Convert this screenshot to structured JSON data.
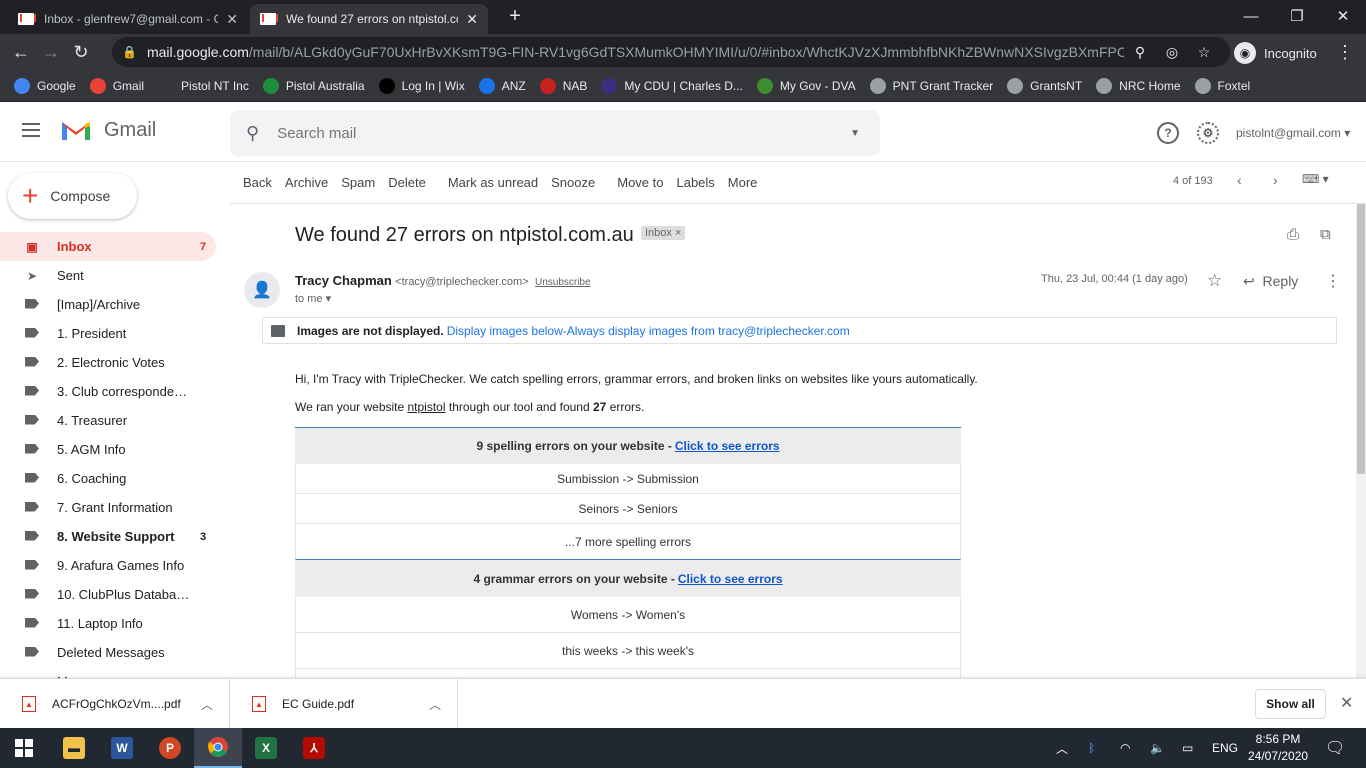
{
  "browser": {
    "tabs": [
      {
        "title": "Inbox - glenfrew7@gmail.com - G"
      },
      {
        "title": "We found 27 errors on ntpistol.co"
      }
    ],
    "url_main": "mail.google.com",
    "url_rest": "/mail/b/ALGkd0yGuF70UxHrBvXKsmT9G-FIN-RV1vg6GdTSXMumkOHMYIMI/u/0/#inbox/WhctKJVzXJmmbhfbNKhZBWnwNXSIvgzBXmFPCR...",
    "incognito_label": "Incognito",
    "bookmarks": [
      {
        "label": "Google",
        "color": "#4285f4"
      },
      {
        "label": "Gmail",
        "color": "#ea4335"
      },
      {
        "label": "Pistol NT Inc",
        "color": "#35363a"
      },
      {
        "label": "Pistol Australia",
        "color": "#1e8e3e"
      },
      {
        "label": "Log In | Wix",
        "color": "#000000"
      },
      {
        "label": "ANZ",
        "color": "#1a73e8"
      },
      {
        "label": "NAB",
        "color": "#c5221f"
      },
      {
        "label": "My CDU | Charles D...",
        "color": "#3c2f80"
      },
      {
        "label": "My Gov - DVA",
        "color": "#3c8d2f"
      },
      {
        "label": "PNT Grant Tracker",
        "color": "#9aa0a6"
      },
      {
        "label": "GrantsNT",
        "color": "#9aa0a6"
      },
      {
        "label": "NRC Home",
        "color": "#9aa0a6"
      },
      {
        "label": "Foxtel",
        "color": "#9aa0a6"
      }
    ]
  },
  "gmail": {
    "logo_text": "Gmail",
    "search_placeholder": "Search mail",
    "account": "pistolnt@gmail.com",
    "compose_label": "Compose",
    "nav": [
      {
        "label": "Inbox",
        "count": "7",
        "icon": "inbox-icon"
      },
      {
        "label": "Sent",
        "count": "",
        "icon": "send-icon"
      },
      {
        "label": "[Imap]/Archive",
        "count": "",
        "icon": "label-icon"
      },
      {
        "label": "1. President",
        "count": "",
        "icon": "label-icon"
      },
      {
        "label": "2. Electronic Votes",
        "count": "",
        "icon": "label-icon"
      },
      {
        "label": "3. Club correspondence",
        "count": "",
        "icon": "label-icon"
      },
      {
        "label": "4. Treasurer",
        "count": "",
        "icon": "label-icon"
      },
      {
        "label": "5. AGM Info",
        "count": "",
        "icon": "label-icon"
      },
      {
        "label": "6. Coaching",
        "count": "",
        "icon": "label-icon"
      },
      {
        "label": "7. Grant Information",
        "count": "",
        "icon": "label-icon"
      },
      {
        "label": "8. Website Support",
        "count": "3",
        "icon": "label-icon"
      },
      {
        "label": "9. Arafura Games Info",
        "count": "",
        "icon": "label-icon"
      },
      {
        "label": "10. ClubPlus Database I...",
        "count": "",
        "icon": "label-icon"
      },
      {
        "label": "11. Laptop Info",
        "count": "",
        "icon": "label-icon"
      },
      {
        "label": "Deleted Messages",
        "count": "",
        "icon": "label-icon"
      },
      {
        "label": "More",
        "count": "",
        "icon": "chevron-down-icon"
      }
    ],
    "actions": [
      "Back",
      "Archive",
      "Spam",
      "Delete",
      "Mark as unread",
      "Snooze",
      "Move to",
      "Labels",
      "More"
    ],
    "pager": "4 of 193"
  },
  "email": {
    "subject": "We found 27 errors on ntpistol.com.au",
    "label_chip": "Inbox",
    "sender_name": "Tracy Chapman",
    "sender_email": "<tracy@triplechecker.com>",
    "unsubscribe": "Unsubscribe",
    "to": "to me",
    "date": "Thu, 23 Jul, 00:44 (1 day ago)",
    "reply_label": "Reply",
    "images_notice_bold": "Images are not displayed.",
    "images_link1": "Display images below",
    "images_sep": " - ",
    "images_link2": "Always display images from tracy@triplechecker.com",
    "intro": "Hi, I'm Tracy with TripleChecker. We catch spelling errors, grammar errors, and broken links on websites like yours automatically.",
    "ran_pre": "We ran your website ",
    "ran_site": "ntpistol",
    "ran_mid": " through our tool and found ",
    "ran_count": "27",
    "ran_post": " errors.",
    "spelling_head": "9 spelling errors on your website - ",
    "spelling_link": "Click to see errors",
    "spelling_rows": [
      "Sumbission -> Submission",
      "Seinors -> Seniors",
      "...7 more spelling errors"
    ],
    "grammar_head": "4 grammar errors on your website - ",
    "grammar_link": "Click to see errors",
    "grammar_rows": [
      "Womens -> Women's",
      "this weeks -> this week's"
    ]
  },
  "downloads": {
    "items": [
      {
        "name": "ACFrOgChkOzVm....pdf"
      },
      {
        "name": "EC Guide.pdf"
      }
    ],
    "show_all": "Show all"
  },
  "taskbar": {
    "lang": "ENG",
    "time": "8:56 PM",
    "date": "24/07/2020"
  }
}
